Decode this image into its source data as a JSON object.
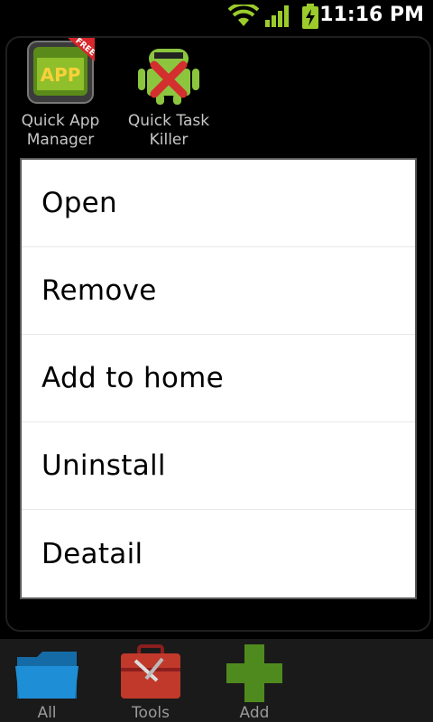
{
  "status_bar": {
    "time": "11:16 PM"
  },
  "home": {
    "apps": [
      {
        "label_line1": "Quick App",
        "label_line2": "Manager",
        "icon": "app-manager-icon",
        "badge": "FREE",
        "icon_text": "APP"
      },
      {
        "label_line1": "Quick Task",
        "label_line2": "Killer",
        "icon": "android-task-killer-icon"
      }
    ]
  },
  "context_menu": {
    "items": [
      "Open",
      "Remove",
      "Add to home",
      "Uninstall",
      "Deatail"
    ]
  },
  "bottom_bar": {
    "tabs": [
      {
        "label": "All",
        "icon": "folder-icon"
      },
      {
        "label": "Tools",
        "icon": "toolbox-icon"
      },
      {
        "label": "Add",
        "icon": "plus-icon"
      }
    ]
  },
  "colors": {
    "accent_green": "#9ccc2c",
    "folder_blue": "#1e8fd6",
    "toolbox_red": "#c0392b"
  }
}
